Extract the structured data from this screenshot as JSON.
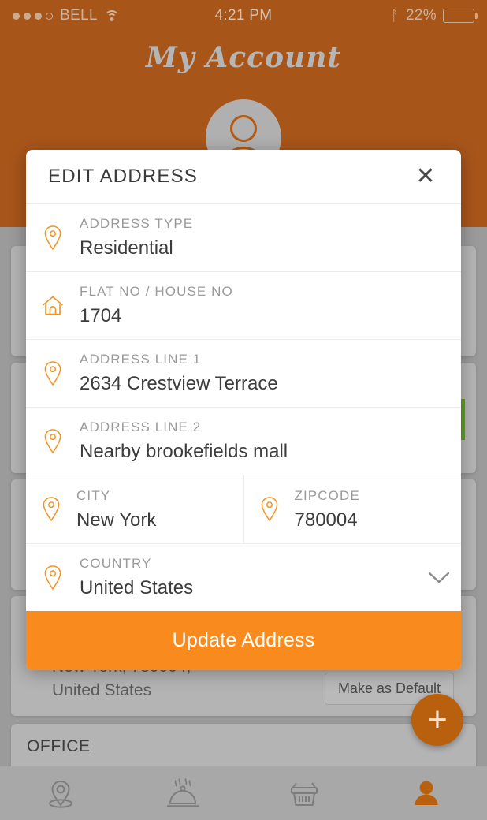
{
  "status_bar": {
    "carrier": "BELL",
    "time": "4:21 PM",
    "battery_percent": "22%",
    "battery_level": 22,
    "signal_dots_filled": 3,
    "signal_dots_total": 4,
    "wifi_icon": "wifi-icon",
    "bluetooth_icon": "bluetooth-icon"
  },
  "header": {
    "title": "My Account",
    "avatar_icon": "person-avatar-icon"
  },
  "background": {
    "address_card_lines": [
      "New York, 780004,",
      "United States"
    ],
    "make_default_label": "Make as Default",
    "office_card_label": "OFFICE",
    "fab_icon": "plus-icon",
    "fab_label": "+"
  },
  "tabbar": {
    "items": [
      {
        "name": "location-tab",
        "icon": "location-pin-icon",
        "active": false
      },
      {
        "name": "food-tab",
        "icon": "food-dome-icon",
        "active": false
      },
      {
        "name": "cart-tab",
        "icon": "shopping-basket-icon",
        "active": false
      },
      {
        "name": "account-tab",
        "icon": "person-icon",
        "active": true
      }
    ]
  },
  "modal": {
    "title": "EDIT ADDRESS",
    "close_icon": "close-icon",
    "chevron_icon": "chevron-down-icon",
    "fields": [
      {
        "label": "ADDRESS TYPE",
        "value": "Residential",
        "icon": "location-pin-icon"
      },
      {
        "label": "FLAT NO / HOUSE NO",
        "value": "1704",
        "icon": "home-icon"
      },
      {
        "label": "ADDRESS LINE 1",
        "value": "2634 Crestview Terrace",
        "icon": "location-pin-icon"
      },
      {
        "label": "ADDRESS LINE 2",
        "value": "Nearby brookefields mall",
        "icon": "location-pin-icon"
      },
      {
        "label": "CITY",
        "value": "New York",
        "icon": "location-pin-icon"
      },
      {
        "label": "ZIPCODE",
        "value": "780004",
        "icon": "location-pin-icon"
      },
      {
        "label": "COUNTRY",
        "value": "United States",
        "icon": "location-pin-icon"
      }
    ],
    "submit_label": "Update Address"
  },
  "colors": {
    "accent_orange": "#F98A1E",
    "header_orange": "#A8551A",
    "overlay_grey": "#9B9B9B",
    "label_grey": "#9A9A9A",
    "value_dark": "#3C3C3C",
    "green_badge": "#5E9E21"
  }
}
